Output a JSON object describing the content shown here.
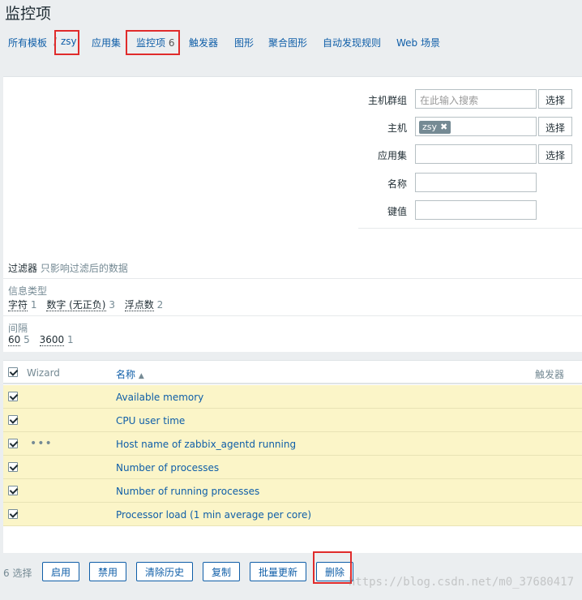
{
  "page": {
    "title": "监控项"
  },
  "nav": {
    "all_templates": "所有模板",
    "separator": "/",
    "host": "zsy",
    "applications": "应用集",
    "items": "监控项",
    "items_count": "6",
    "triggers": "触发器",
    "graphs": "图形",
    "screens": "聚合图形",
    "discovery": "自动发现规则",
    "web": "Web 场景"
  },
  "filter": {
    "host_group_label": "主机群组",
    "host_group_placeholder": "在此输入搜索",
    "host_label": "主机",
    "host_chip": "zsy",
    "application_label": "应用集",
    "name_label": "名称",
    "key_label": "键值",
    "select_button": "选择"
  },
  "subfilter": {
    "title": "过滤器",
    "hint": "只影响过滤后的数据",
    "info_type_label": "信息类型",
    "info_types": [
      {
        "label": "字符",
        "count": "1"
      },
      {
        "label": "数字 (无正负)",
        "count": "3"
      },
      {
        "label": "浮点数",
        "count": "2"
      }
    ],
    "interval_label": "间隔",
    "intervals": [
      {
        "label": "60",
        "count": "5"
      },
      {
        "label": "3600",
        "count": "1"
      }
    ]
  },
  "table": {
    "col_wizard": "Wizard",
    "col_name": "名称",
    "sort_icon": "▲",
    "col_triggers": "触发器",
    "wizard_dots": "•••",
    "rows": [
      {
        "name": "Available memory"
      },
      {
        "name": "CPU user time"
      },
      {
        "name": "Host name of zabbix_agentd running"
      },
      {
        "name": "Number of processes"
      },
      {
        "name": "Number of running processes"
      },
      {
        "name": "Processor load (1 min average per core)"
      }
    ]
  },
  "actions": {
    "selected": "6 选择",
    "enable": "启用",
    "disable": "禁用",
    "clear_history": "清除历史",
    "copy": "复制",
    "mass_update": "批量更新",
    "delete": "删除"
  },
  "watermark": "https://blog.csdn.net/m0_37680417",
  "colors": {
    "link": "#0f5ea8",
    "highlight_row": "#fbf5c8",
    "annotation_red": "#e02b2b"
  }
}
